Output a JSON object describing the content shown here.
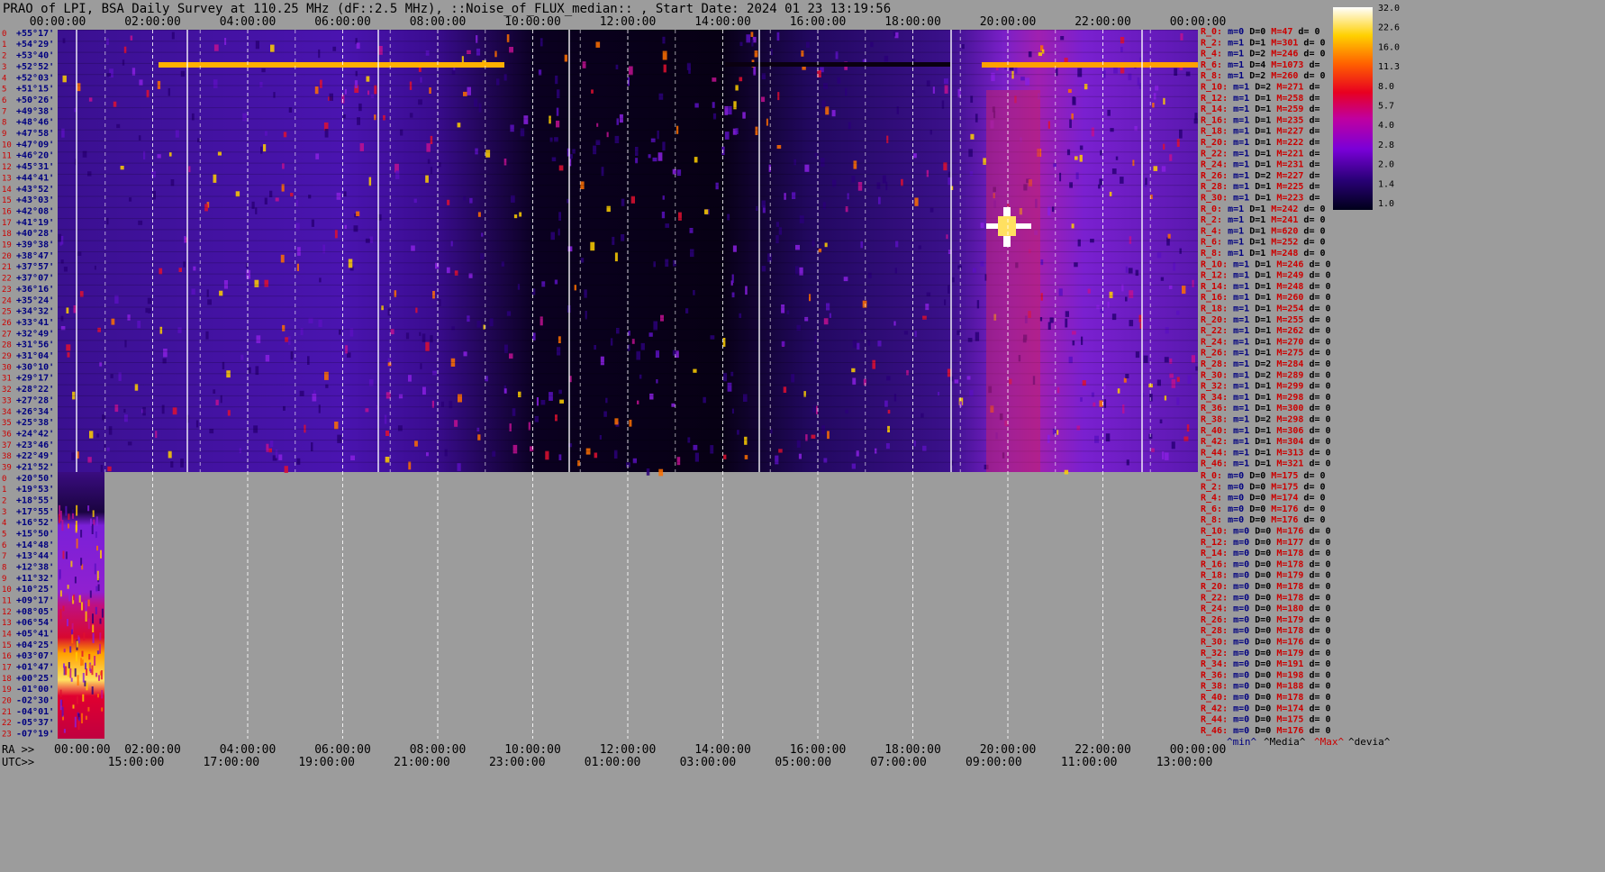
{
  "title": "PRAO of LPI, BSA Daily Survey at 110.25 MHz (dF::2.5 MHz), ::Noise_of_FLUX_median:: , Start Date: 2024 01 23 13:19:56",
  "colors": {
    "background": "#9c9c9c",
    "label_red": "#cc0000",
    "label_blue": "#000080",
    "grid": "#ffffff"
  },
  "chart_data": {
    "type": "heatmap",
    "title": "PRAO of LPI, BSA Daily Survey at 110.25 MHz (dF::2.5 MHz), ::Noise_of_FLUX_median:: , Start Date: 2024 01 23 13:19:56",
    "colormap": "gnuplot-like (black-purple-red-yellow-white)",
    "colorbar": {
      "ticks": [
        "32.0",
        "22.6",
        "16.0",
        "11.3",
        "8.0",
        "5.7",
        "4.0",
        "2.8",
        "2.0",
        "1.4",
        "1.0"
      ],
      "scale": "log"
    },
    "top_time_axis": [
      "00:00:00",
      "02:00:00",
      "04:00:00",
      "06:00:00",
      "08:00:00",
      "10:00:00",
      "12:00:00",
      "14:00:00",
      "16:00:00",
      "18:00:00",
      "20:00:00",
      "22:00:00",
      "00:00:00"
    ],
    "ra_axis_label": "RA >>",
    "ra_axis": [
      "00:00:00",
      "02:00:00",
      "04:00:00",
      "06:00:00",
      "08:00:00",
      "10:00:00",
      "12:00:00",
      "14:00:00",
      "16:00:00",
      "18:00:00",
      "20:00:00",
      "22:00:00",
      "00:00:00"
    ],
    "utc_axis_label": "UTC>>",
    "utc_axis": [
      "15:00:00",
      "17:00:00",
      "19:00:00",
      "21:00:00",
      "23:00:00",
      "01:00:00",
      "03:00:00",
      "05:00:00",
      "07:00:00",
      "09:00:00",
      "11:00:00",
      "13:00:00"
    ],
    "upper_dec_labels": [
      "+55°17'",
      "+54°29'",
      "+53°40'",
      "+52°52'",
      "+52°03'",
      "+51°15'",
      "+50°26'",
      "+49°38'",
      "+48°46'",
      "+47°58'",
      "+47°09'",
      "+46°20'",
      "+45°31'",
      "+44°41'",
      "+43°52'",
      "+43°03'",
      "+42°08'",
      "+41°19'",
      "+40°28'",
      "+39°38'",
      "+38°47'",
      "+37°57'",
      "+37°07'",
      "+36°16'",
      "+35°24'",
      "+34°32'",
      "+33°41'",
      "+32°49'",
      "+31°56'",
      "+31°04'",
      "+30°10'",
      "+29°17'",
      "+28°22'",
      "+27°28'",
      "+26°34'",
      "+25°38'",
      "+24°42'",
      "+23°46'",
      "+22°49'",
      "+21°52'"
    ],
    "lower_dec_labels": [
      "+20°50'",
      "+19°53'",
      "+18°55'",
      "+17°55'",
      "+16°52'",
      "+15°50'",
      "+14°48'",
      "+13°44'",
      "+12°38'",
      "+11°32'",
      "+10°25'",
      "+09°17'",
      "+08°05'",
      "+06°54'",
      "+05°41'",
      "+04°25'",
      "+03°07'",
      "+01°47'",
      "+00°25'",
      "-01°00'",
      "-02°30'",
      "-04°01'",
      "-05°37'",
      "-07°19'"
    ],
    "legend_bottom": [
      "^min^",
      "^Media^",
      "^Max^",
      "^devia^"
    ],
    "stats_upper": [
      {
        "r": "R_0:",
        "m": "m=0",
        "D": "D=0",
        "M": "M=47",
        "d": "d= 0"
      },
      {
        "r": "R_2:",
        "m": "m=1",
        "D": "D=1",
        "M": "M=301",
        "d": "d= 0"
      },
      {
        "r": "R_4:",
        "m": "m=1",
        "D": "D=2",
        "M": "M=246",
        "d": "d= 0"
      },
      {
        "r": "R_6:",
        "m": "m=1",
        "D": "D=4",
        "M": "M=1073",
        "d": "d="
      },
      {
        "r": "R_8:",
        "m": "m=1",
        "D": "D=2",
        "M": "M=260",
        "d": "d= 0"
      },
      {
        "r": "R_10:",
        "m": "m=1",
        "D": "D=2",
        "M": "M=271",
        "d": "d="
      },
      {
        "r": "R_12:",
        "m": "m=1",
        "D": "D=1",
        "M": "M=258",
        "d": "d="
      },
      {
        "r": "R_14:",
        "m": "m=1",
        "D": "D=1",
        "M": "M=259",
        "d": "d="
      },
      {
        "r": "R_16:",
        "m": "m=1",
        "D": "D=1",
        "M": "M=235",
        "d": "d="
      },
      {
        "r": "R_18:",
        "m": "m=1",
        "D": "D=1",
        "M": "M=227",
        "d": "d="
      },
      {
        "r": "R_20:",
        "m": "m=1",
        "D": "D=1",
        "M": "M=222",
        "d": "d="
      },
      {
        "r": "R_22:",
        "m": "m=1",
        "D": "D=1",
        "M": "M=221",
        "d": "d="
      },
      {
        "r": "R_24:",
        "m": "m=1",
        "D": "D=1",
        "M": "M=231",
        "d": "d="
      },
      {
        "r": "R_26:",
        "m": "m=1",
        "D": "D=2",
        "M": "M=227",
        "d": "d="
      },
      {
        "r": "R_28:",
        "m": "m=1",
        "D": "D=1",
        "M": "M=225",
        "d": "d="
      },
      {
        "r": "R_30:",
        "m": "m=1",
        "D": "D=1",
        "M": "M=223",
        "d": "d="
      },
      {
        "r": "R_0:",
        "m": "m=1",
        "D": "D=1",
        "M": "M=242",
        "d": "d= 0"
      },
      {
        "r": "R_2:",
        "m": "m=1",
        "D": "D=1",
        "M": "M=241",
        "d": "d= 0"
      },
      {
        "r": "R_4:",
        "m": "m=1",
        "D": "D=1",
        "M": "M=620",
        "d": "d= 0"
      },
      {
        "r": "R_6:",
        "m": "m=1",
        "D": "D=1",
        "M": "M=252",
        "d": "d= 0"
      },
      {
        "r": "R_8:",
        "m": "m=1",
        "D": "D=1",
        "M": "M=248",
        "d": "d= 0"
      },
      {
        "r": "R_10:",
        "m": "m=1",
        "D": "D=1",
        "M": "M=246",
        "d": "d= 0"
      },
      {
        "r": "R_12:",
        "m": "m=1",
        "D": "D=1",
        "M": "M=249",
        "d": "d= 0"
      },
      {
        "r": "R_14:",
        "m": "m=1",
        "D": "D=1",
        "M": "M=248",
        "d": "d= 0"
      },
      {
        "r": "R_16:",
        "m": "m=1",
        "D": "D=1",
        "M": "M=260",
        "d": "d= 0"
      },
      {
        "r": "R_18:",
        "m": "m=1",
        "D": "D=1",
        "M": "M=254",
        "d": "d= 0"
      },
      {
        "r": "R_20:",
        "m": "m=1",
        "D": "D=1",
        "M": "M=255",
        "d": "d= 0"
      },
      {
        "r": "R_22:",
        "m": "m=1",
        "D": "D=1",
        "M": "M=262",
        "d": "d= 0"
      },
      {
        "r": "R_24:",
        "m": "m=1",
        "D": "D=1",
        "M": "M=270",
        "d": "d= 0"
      },
      {
        "r": "R_26:",
        "m": "m=1",
        "D": "D=1",
        "M": "M=275",
        "d": "d= 0"
      },
      {
        "r": "R_28:",
        "m": "m=1",
        "D": "D=2",
        "M": "M=284",
        "d": "d= 0"
      },
      {
        "r": "R_30:",
        "m": "m=1",
        "D": "D=2",
        "M": "M=289",
        "d": "d= 0"
      },
      {
        "r": "R_32:",
        "m": "m=1",
        "D": "D=1",
        "M": "M=299",
        "d": "d= 0"
      },
      {
        "r": "R_34:",
        "m": "m=1",
        "D": "D=1",
        "M": "M=298",
        "d": "d= 0"
      },
      {
        "r": "R_36:",
        "m": "m=1",
        "D": "D=1",
        "M": "M=300",
        "d": "d= 0"
      },
      {
        "r": "R_38:",
        "m": "m=1",
        "D": "D=2",
        "M": "M=298",
        "d": "d= 0"
      },
      {
        "r": "R_40:",
        "m": "m=1",
        "D": "D=1",
        "M": "M=306",
        "d": "d= 0"
      },
      {
        "r": "R_42:",
        "m": "m=1",
        "D": "D=1",
        "M": "M=304",
        "d": "d= 0"
      },
      {
        "r": "R_44:",
        "m": "m=1",
        "D": "D=1",
        "M": "M=313",
        "d": "d= 0"
      },
      {
        "r": "R_46:",
        "m": "m=1",
        "D": "D=1",
        "M": "M=321",
        "d": "d= 0"
      }
    ],
    "stats_lower": [
      {
        "r": "R_0:",
        "m": "m=0",
        "D": "D=0",
        "M": "M=175",
        "d": "d= 0"
      },
      {
        "r": "R_2:",
        "m": "m=0",
        "D": "D=0",
        "M": "M=175",
        "d": "d= 0"
      },
      {
        "r": "R_4:",
        "m": "m=0",
        "D": "D=0",
        "M": "M=174",
        "d": "d= 0"
      },
      {
        "r": "R_6:",
        "m": "m=0",
        "D": "D=0",
        "M": "M=176",
        "d": "d= 0"
      },
      {
        "r": "R_8:",
        "m": "m=0",
        "D": "D=0",
        "M": "M=176",
        "d": "d= 0"
      },
      {
        "r": "R_10:",
        "m": "m=0",
        "D": "D=0",
        "M": "M=176",
        "d": "d= 0"
      },
      {
        "r": "R_12:",
        "m": "m=0",
        "D": "D=0",
        "M": "M=177",
        "d": "d= 0"
      },
      {
        "r": "R_14:",
        "m": "m=0",
        "D": "D=0",
        "M": "M=178",
        "d": "d= 0"
      },
      {
        "r": "R_16:",
        "m": "m=0",
        "D": "D=0",
        "M": "M=178",
        "d": "d= 0"
      },
      {
        "r": "R_18:",
        "m": "m=0",
        "D": "D=0",
        "M": "M=179",
        "d": "d= 0"
      },
      {
        "r": "R_20:",
        "m": "m=0",
        "D": "D=0",
        "M": "M=178",
        "d": "d= 0"
      },
      {
        "r": "R_22:",
        "m": "m=0",
        "D": "D=0",
        "M": "M=178",
        "d": "d= 0"
      },
      {
        "r": "R_24:",
        "m": "m=0",
        "D": "D=0",
        "M": "M=180",
        "d": "d= 0"
      },
      {
        "r": "R_26:",
        "m": "m=0",
        "D": "D=0",
        "M": "M=179",
        "d": "d= 0"
      },
      {
        "r": "R_28:",
        "m": "m=0",
        "D": "D=0",
        "M": "M=178",
        "d": "d= 0"
      },
      {
        "r": "R_30:",
        "m": "m=0",
        "D": "D=0",
        "M": "M=176",
        "d": "d= 0"
      },
      {
        "r": "R_32:",
        "m": "m=0",
        "D": "D=0",
        "M": "M=179",
        "d": "d= 0"
      },
      {
        "r": "R_34:",
        "m": "m=0",
        "D": "D=0",
        "M": "M=191",
        "d": "d= 0"
      },
      {
        "r": "R_36:",
        "m": "m=0",
        "D": "D=0",
        "M": "M=198",
        "d": "d= 0"
      },
      {
        "r": "R_38:",
        "m": "m=0",
        "D": "D=0",
        "M": "M=188",
        "d": "d= 0"
      },
      {
        "r": "R_40:",
        "m": "m=0",
        "D": "D=0",
        "M": "M=178",
        "d": "d= 0"
      },
      {
        "r": "R_42:",
        "m": "m=0",
        "D": "D=0",
        "M": "M=174",
        "d": "d= 0"
      },
      {
        "r": "R_44:",
        "m": "m=0",
        "D": "D=0",
        "M": "M=175",
        "d": "d= 0"
      },
      {
        "r": "R_46:",
        "m": "m=0",
        "D": "D=0",
        "M": "M=176",
        "d": "d= 0"
      }
    ]
  }
}
